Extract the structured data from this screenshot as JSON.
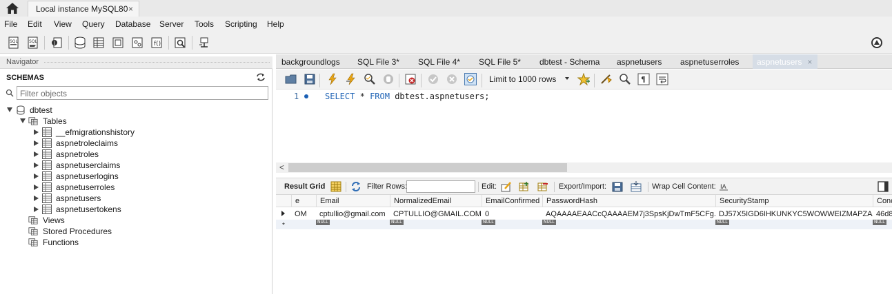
{
  "titlebar": {
    "instance_tab": "Local instance MySQL80",
    "close_glyph": "×",
    "home_icon": "home-icon"
  },
  "menu": [
    "File",
    "Edit",
    "View",
    "Query",
    "Database",
    "Server",
    "Tools",
    "Scripting",
    "Help"
  ],
  "navigator": {
    "header": "Navigator",
    "section_title": "SCHEMAS",
    "filter_placeholder": "Filter objects",
    "schema": "dbtest",
    "tables_label": "Tables",
    "tables": [
      "__efmigrationshistory",
      "aspnetroleclaims",
      "aspnetroles",
      "aspnetuserclaims",
      "aspnetuserlogins",
      "aspnetuserroles",
      "aspnetusers",
      "aspnetusertokens"
    ],
    "views_label": "Views",
    "procedures_label": "Stored Procedures",
    "functions_label": "Functions"
  },
  "editor_tabs": [
    "backgroundlogs",
    "SQL File 3*",
    "SQL File 4*",
    "SQL File 5*",
    "dbtest - Schema",
    "aspnetusers",
    "aspnetuserroles",
    "aspnetusers"
  ],
  "editor_toolbar": {
    "limit_label": "Limit to 1000 rows"
  },
  "editor": {
    "line_number": "1",
    "sql_select": "SELECT",
    "sql_star": "*",
    "sql_from": "FROM",
    "sql_rest": "dbtest.aspnetusers;"
  },
  "result_toolbar": {
    "result_grid": "Result Grid",
    "filter_rows": "Filter Rows:",
    "edit": "Edit:",
    "export_import": "Export/Import:",
    "wrap_cell": "Wrap Cell Content:"
  },
  "grid": {
    "columns": [
      "e",
      "Email",
      "NormalizedEmail",
      "EmailConfirmed",
      "PasswordHash",
      "SecurityStamp",
      "Conc"
    ],
    "row": [
      "OM",
      "cptullio@gmail.com",
      "CPTULLIO@GMAIL.COM",
      "0",
      "AQAAAAEAACcQAAAAEM7j3SpsKjDwTmF5CFg...",
      "DJ57X5IGD6IHKUNKYC5WOWWEIZMAPZAA",
      "46d8"
    ],
    "null_label": "NULL",
    "new_row_marker": "*"
  }
}
